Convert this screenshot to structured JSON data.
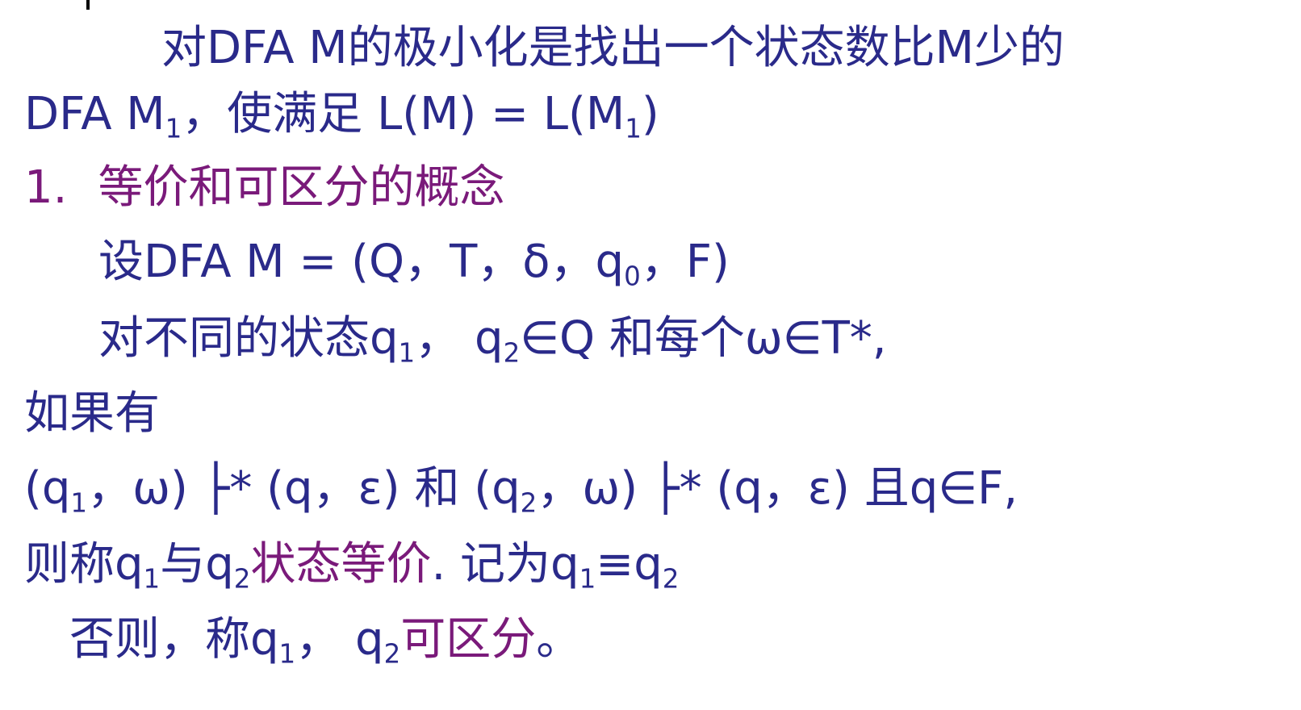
{
  "colors": {
    "text": "#2a2a8a",
    "highlight": "#7a1a7a",
    "background": "#ffffff"
  },
  "line1": {
    "text": "对DFA  M的极小化是找出一个状态数比M少的"
  },
  "line2": {
    "prefix": "DFA  M",
    "sub1": "1",
    "middle": "，使满足 L(M) = L(M",
    "sub2": "1",
    "suffix": ")"
  },
  "heading": {
    "number": "1.",
    "title": "等价和可区分的概念"
  },
  "line4": {
    "prefix": "设DFA  M = (Q，T，δ，q",
    "sub": "0",
    "suffix": "，F)"
  },
  "line5": {
    "a": "对不同的状态q",
    "sub1": "1",
    "b": "，  q",
    "sub2": "2",
    "c": "∈Q 和每个ω∈T*,"
  },
  "line6": {
    "text": "如果有"
  },
  "line7": {
    "a": "(q",
    "sub1": "1",
    "b": "，ω) ├* (q，ε) 和 (q",
    "sub2": "2",
    "c": "，ω) ├* (q，ε) 且q∈F,"
  },
  "line8": {
    "a": "则称q",
    "sub1": "1",
    "b": "与q",
    "sub2": "2",
    "term": "状态等价",
    "c": ". 记为q",
    "sub3": "1",
    "d": "≡q",
    "sub4": "2"
  },
  "line9": {
    "a": "否则，称q",
    "sub1": "1",
    "b": "，  q",
    "sub2": "2",
    "term": "可区分",
    "c": "。"
  }
}
